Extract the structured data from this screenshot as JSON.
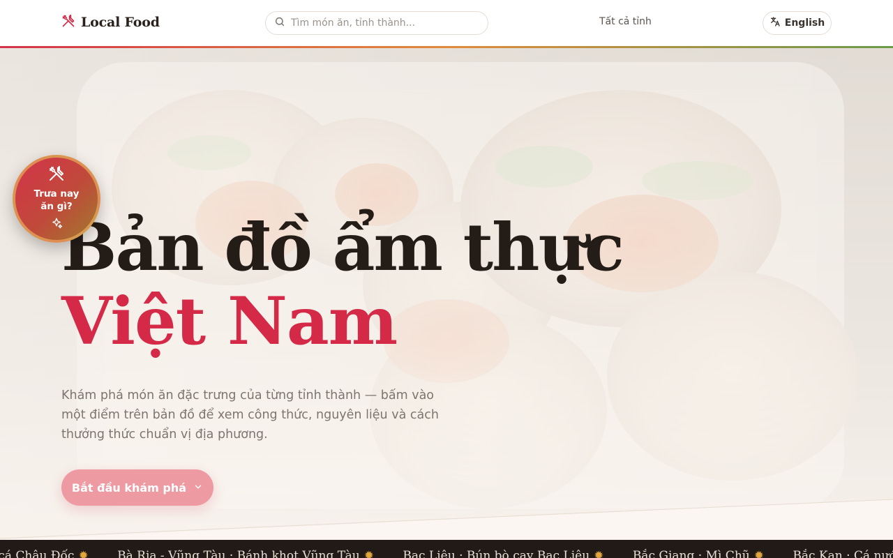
{
  "header": {
    "logo_text": "Local Food",
    "search_placeholder": "Tìm món ăn, tỉnh thành...",
    "all_provinces": "Tất cả tỉnh",
    "language": "English"
  },
  "hero": {
    "title_line1": "Bản đồ ẩm thực",
    "title_line2": "Việt Nam",
    "description": "Khám phá món ăn đặc trưng của từng tỉnh thành — bấm vào một điểm trên bản đồ để xem công thức, nguyên liệu và cách thưởng thức chuẩn vị địa phương.",
    "cta_label": "Bắt đầu khám phá"
  },
  "lunch_badge": {
    "label": "Trưa nay ăn gì?"
  },
  "ticker": {
    "items": [
      "ún cá Châu Đốc",
      "Bà Rịa - Vũng Tàu · Bánh khọt Vũng Tàu",
      "Bạc Liêu · Bún bò cay Bạc Liêu",
      "Bắc Giang · Mì Chũ",
      "Bắc Kạn · Cá nướng"
    ]
  },
  "colors": {
    "accent": "#d42a47",
    "cta": "#ee9aa2",
    "ticker_bg": "#211a16"
  }
}
